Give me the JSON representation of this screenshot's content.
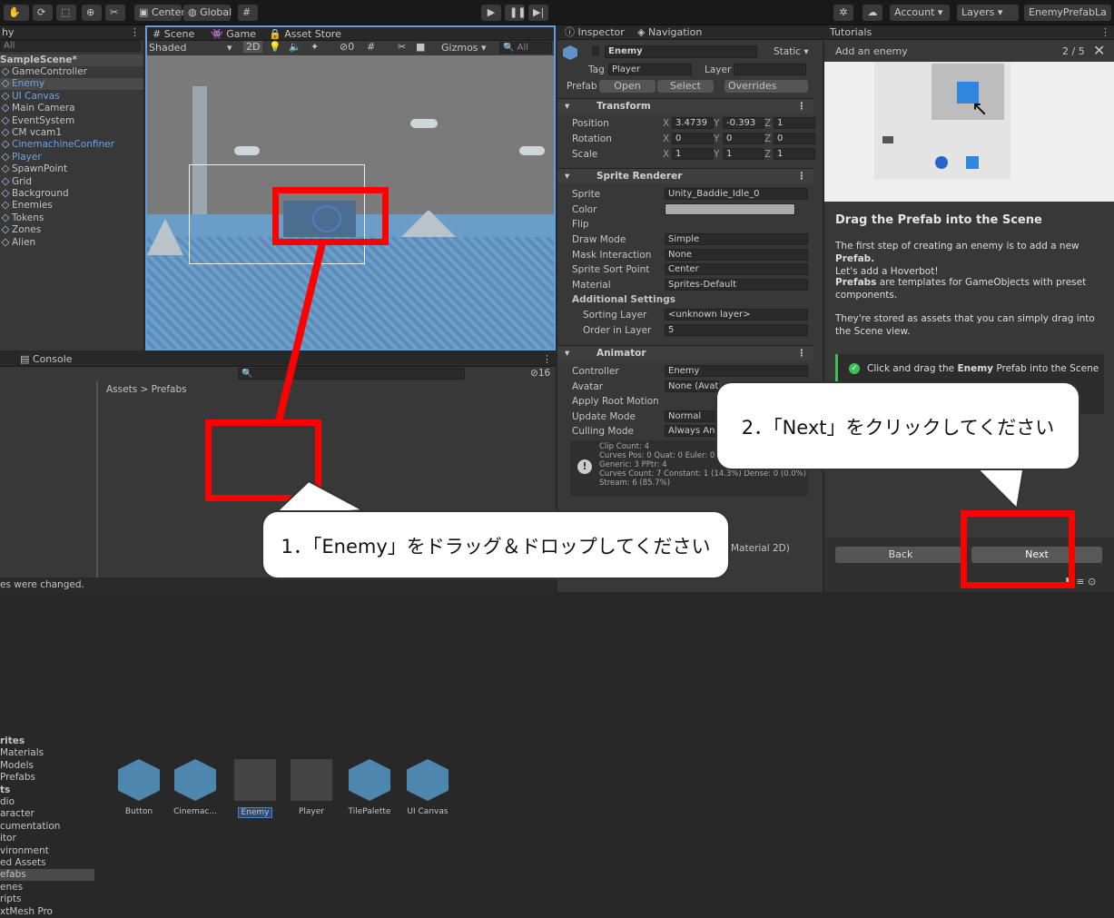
{
  "toolbar": {
    "center": "Center",
    "global": "Global",
    "account": "Account",
    "layers": "Layers",
    "layout": "EnemyPrefabLa"
  },
  "hierarchy": {
    "tab": "hy",
    "search": "All",
    "scene": "SampleScene*",
    "items": [
      "GameController",
      "Enemy",
      "UI Canvas",
      "Main Camera",
      "EventSystem",
      "CM vcam1",
      "CinemachineConfiner",
      "Player",
      "SpawnPoint",
      "Grid",
      "Background",
      "Enemies",
      "Tokens",
      "Zones",
      "Alien"
    ]
  },
  "scene": {
    "tabs": [
      "Scene",
      "Game",
      "Asset Store"
    ],
    "shading": "Shaded",
    "mode2d": "2D",
    "gizmos": "Gizmos",
    "search": "All",
    "hidden_count": "0"
  },
  "project": {
    "tab": "Console",
    "breadcrumb": "Assets > Prefabs",
    "count": "16",
    "tree": [
      "rites",
      "Materials",
      "Models",
      "Prefabs",
      "ts",
      "dio",
      "aracter",
      "cumentation",
      "itor",
      "vironment",
      "ed Assets",
      "efabs",
      "enes",
      "ripts",
      "xtMesh Pro"
    ],
    "assets": [
      "Button",
      "Cinemac...",
      "Enemy",
      "Player",
      "TilePalette",
      "UI Canvas"
    ],
    "status": "es were changed."
  },
  "inspector": {
    "tabs": [
      "Inspector",
      "Navigation"
    ],
    "name": "Enemy",
    "static": "Static",
    "tag_label": "Tag",
    "tag": "Player",
    "layer_label": "Layer",
    "prefab_label": "Prefab",
    "open": "Open",
    "select": "Select",
    "overrides": "Overrides",
    "transform": "Transform",
    "position": "Position",
    "rotation": "Rotation",
    "scale": "Scale",
    "pos": [
      "3.4739",
      "-0.393",
      "1"
    ],
    "rot": [
      "0",
      "0",
      "0"
    ],
    "scl": [
      "1",
      "1",
      "1"
    ],
    "sprite_renderer": "Sprite Renderer",
    "sprite_label": "Sprite",
    "sprite": "Unity_Baddie_Idle_0",
    "color_label": "Color",
    "flip_label": "Flip",
    "draw_mode_label": "Draw Mode",
    "draw_mode": "Simple",
    "mask_label": "Mask Interaction",
    "mask": "None",
    "sort_point_label": "Sprite Sort Point",
    "sort_point": "Center",
    "material_label": "Material",
    "material": "Sprites-Default",
    "additional": "Additional Settings",
    "sorting_layer_label": "Sorting Layer",
    "sorting_layer": "<unknown layer>",
    "order_label": "Order in Layer",
    "order": "5",
    "animator": "Animator",
    "controller_label": "Controller",
    "controller": "Enemy",
    "avatar_label": "Avatar",
    "avatar": "None (Avat",
    "root_motion_label": "Apply Root Motion",
    "update_mode_label": "Update Mode",
    "update_mode": "Normal",
    "culling_label": "Culling Mode",
    "culling": "Always An",
    "info": [
      "Clip Count: 4",
      "Curves Pos: 0 Quat: 0 Euler: 0",
      "Generic: 3 PPtr: 4",
      "Curves Count: 7 Constant: 1 (14.3%) Dense: 0 (0.0%)",
      "Stream: 6 (85.7%)"
    ],
    "material2d": "Material 2D)"
  },
  "tutorial": {
    "tab": "Tutorials",
    "header": "Add an enemy",
    "page": "2 / 5",
    "title": "Drag the Prefab into the Scene",
    "p1a": "The first step of creating an enemy is to add a new ",
    "p1b": "Prefab.",
    "p1c": "Let's add a Hoverbot!",
    "p2a": "Prefabs",
    "p2b": " are templates for GameObjects with preset components.",
    "p3": "They're stored as assets that you can simply drag into the Scene view.",
    "task_a": "Click and drag the ",
    "task_b": "Enemy",
    "task_c": " Prefab into the Scene",
    "back": "Back",
    "next": "Next"
  },
  "callouts": {
    "step1": "1．「Enemy」をドラッグ＆ドロップしてください",
    "step2": "2．「Next」をクリックしてください"
  },
  "colors": {
    "accent": "#4c7fbf",
    "highlight": "#ff0000",
    "panel": "#383838"
  }
}
